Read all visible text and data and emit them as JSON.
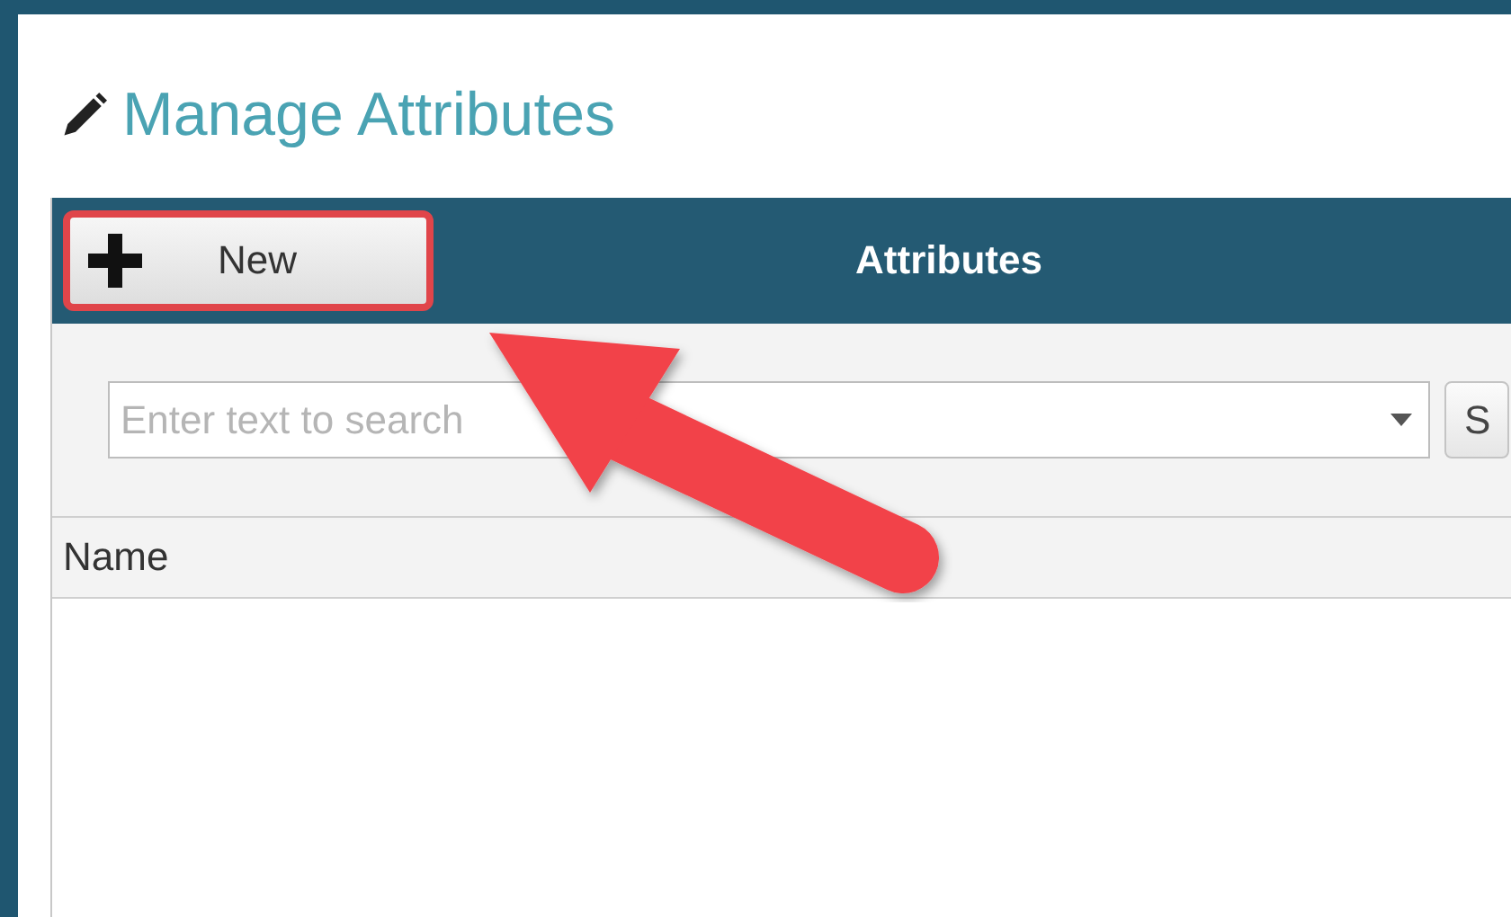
{
  "page": {
    "title": "Manage Attributes"
  },
  "panel": {
    "title": "Attributes",
    "new_button": {
      "label": "New",
      "highlighted": true
    }
  },
  "search": {
    "placeholder": "Enter text to search",
    "button_label": "S"
  },
  "table": {
    "columns": [
      "Name"
    ]
  }
}
